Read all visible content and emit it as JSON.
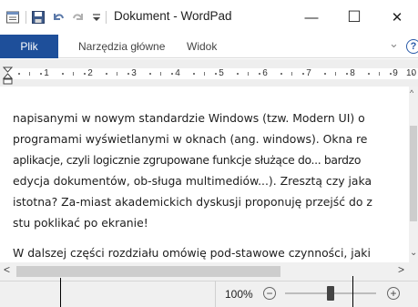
{
  "window": {
    "title": "Dokument - WordPad",
    "minimize_glyph": "—",
    "maximize_glyph": "☐",
    "close_glyph": "✕"
  },
  "quick_access": {
    "items": [
      "wordpad-app-icon",
      "save-icon",
      "undo-icon",
      "redo-icon",
      "customize-qat-icon"
    ]
  },
  "ribbon": {
    "file_tab": "Plik",
    "tabs": [
      "Narzędzia główne",
      "Widok"
    ],
    "collapse_glyph": "⌄",
    "help_glyph": "?"
  },
  "ruler": {
    "numbers": [
      "1",
      "2",
      "3",
      "4",
      "5",
      "6",
      "7",
      "8",
      "9",
      "10"
    ]
  },
  "document": {
    "lines": [
      "napisanymi w nowym standardzie Windows (tzw. Modern UI) o",
      "programami wyświetlanymi w oknach (ang. windows). Okna re",
      "aplikacje, czyli logicznie zgrupowane funkcje służące do... bardzo",
      "edycja dokumentów, ob-sługa multimediów...). Zresztą czy jaka",
      "istotna? Za-miast akademickich dyskusji proponuję przejść do z",
      "stu poklikać po ekranie!",
      "W dalszej części rozdziału omówię pod-stawowe czynności, jaki"
    ]
  },
  "status": {
    "zoom": "100%",
    "zoom_out_glyph": "−",
    "zoom_in_glyph": "+",
    "zoom_level_fraction": 0.5
  },
  "scrollbars": {
    "left_arrow": "<",
    "right_arrow": ">",
    "up_arrow": "^",
    "down_arrow": "⌄"
  },
  "colors": {
    "file_tab_bg": "#1e4f9a",
    "accent": "#2a5aa8"
  }
}
